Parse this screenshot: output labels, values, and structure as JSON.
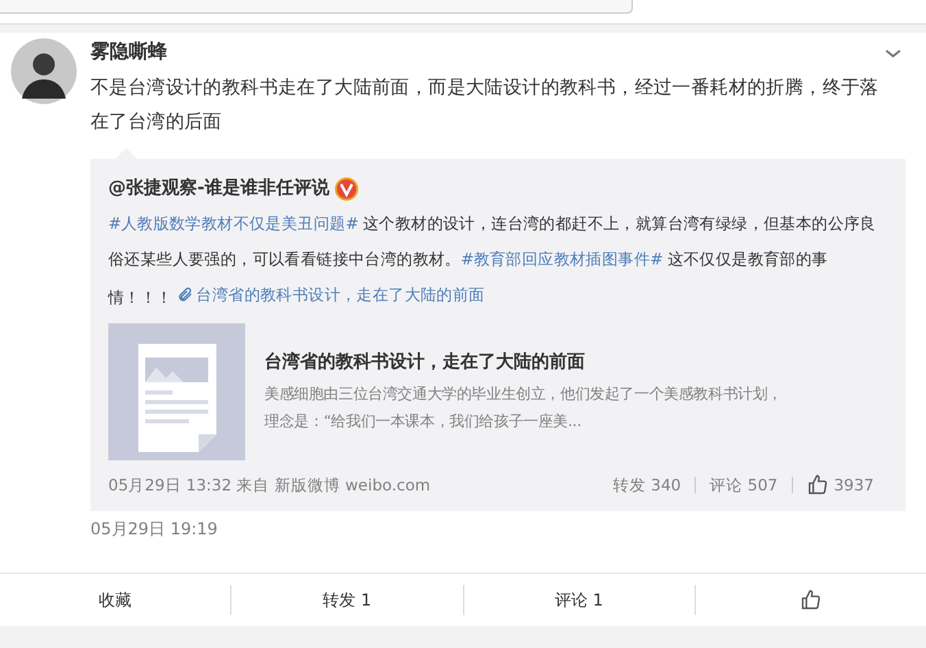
{
  "post": {
    "author": "雾隐嘶蜂",
    "text": "不是台湾设计的教科书走在了大陆前面，而是大陆设计的教科书，经过一番耗材的折腾，终于落在了台湾的后面",
    "time": "05月29日 19:19"
  },
  "repost": {
    "author": "@张捷观察-谁是谁非任评说",
    "verified": true,
    "content": [
      {
        "kind": "topic",
        "text": "#人教版数学教材不仅是美丑问题#"
      },
      {
        "kind": "text",
        "text": " 这个教材的设计，连台湾的都赶不上，就算台湾有绿绿，但基本的公序良俗还某些人要强的，可以看看链接中台湾的教材。"
      },
      {
        "kind": "topic",
        "text": "#教育部回应教材插图事件#"
      },
      {
        "kind": "text",
        "text": " 这不仅仅是教育部的事情！！！ "
      },
      {
        "kind": "link",
        "text": "台湾省的教科书设计，走在了大陆的前面"
      }
    ],
    "card": {
      "title": "台湾省的教科书设计，走在了大陆的前面",
      "summary": "美感细胞由三位台湾交通大学的毕业生创立，他们发起了一个美感教科书计划，理念是：“给我们一本课本，我们给孩子一座美..."
    },
    "meta": "05月29日 13:32 来自 新版微博 weibo.com",
    "reposts": "转发 340",
    "comments": "评论 507",
    "likes": "3937"
  },
  "actions": [
    {
      "kind": "text",
      "label": "收藏"
    },
    {
      "kind": "text",
      "label": "转发 1"
    },
    {
      "kind": "text",
      "label": "评论 1"
    },
    {
      "kind": "like"
    }
  ]
}
